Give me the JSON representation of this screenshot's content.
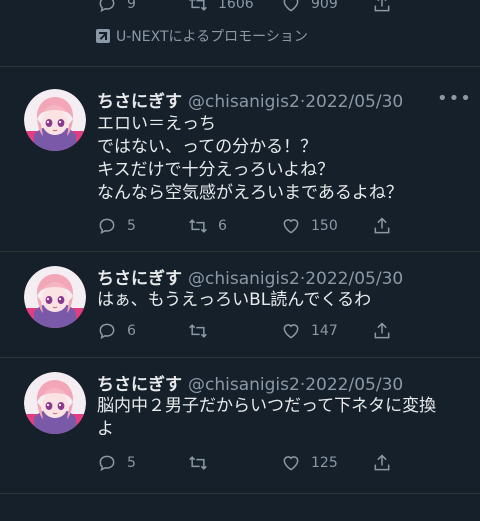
{
  "top_tweet": {
    "replies": "9",
    "retweets": "1606",
    "likes": "909",
    "promo_text": "U-NEXTによるプロモーション"
  },
  "tweets": [
    {
      "name": "ちさにぎす",
      "handle": "@chisanigis2",
      "date": "·2022/05/30",
      "lines": [
        "エロい＝えっち",
        "ではない、っての分かる！？",
        "キスだけで十分えっろいよね？",
        "なんなら空気感がえろいまであるよね？"
      ],
      "replies": "5",
      "retweets": "6",
      "likes": "150"
    },
    {
      "name": "ちさにぎす",
      "handle": "@chisanigis2",
      "date": "·2022/05/30",
      "lines": [
        "はぁ、もうえっろいBL読んでくるわ"
      ],
      "replies": "6",
      "retweets": "",
      "likes": "147"
    },
    {
      "name": "ちさにぎす",
      "handle": "@chisanigis2",
      "date": "·2022/05/30",
      "lines": [
        "脳内中２男子だからいつだって下ネタに変換",
        "よ"
      ],
      "replies": "5",
      "retweets": "",
      "likes": "125"
    }
  ],
  "colors": {
    "background": "#15202b",
    "text": "#e7e9ea",
    "muted": "#8b98a5",
    "divider": "#2f3336"
  },
  "icons": [
    "reply-icon",
    "retweet-icon",
    "like-icon",
    "share-icon",
    "promoted-icon",
    "more-icon"
  ]
}
